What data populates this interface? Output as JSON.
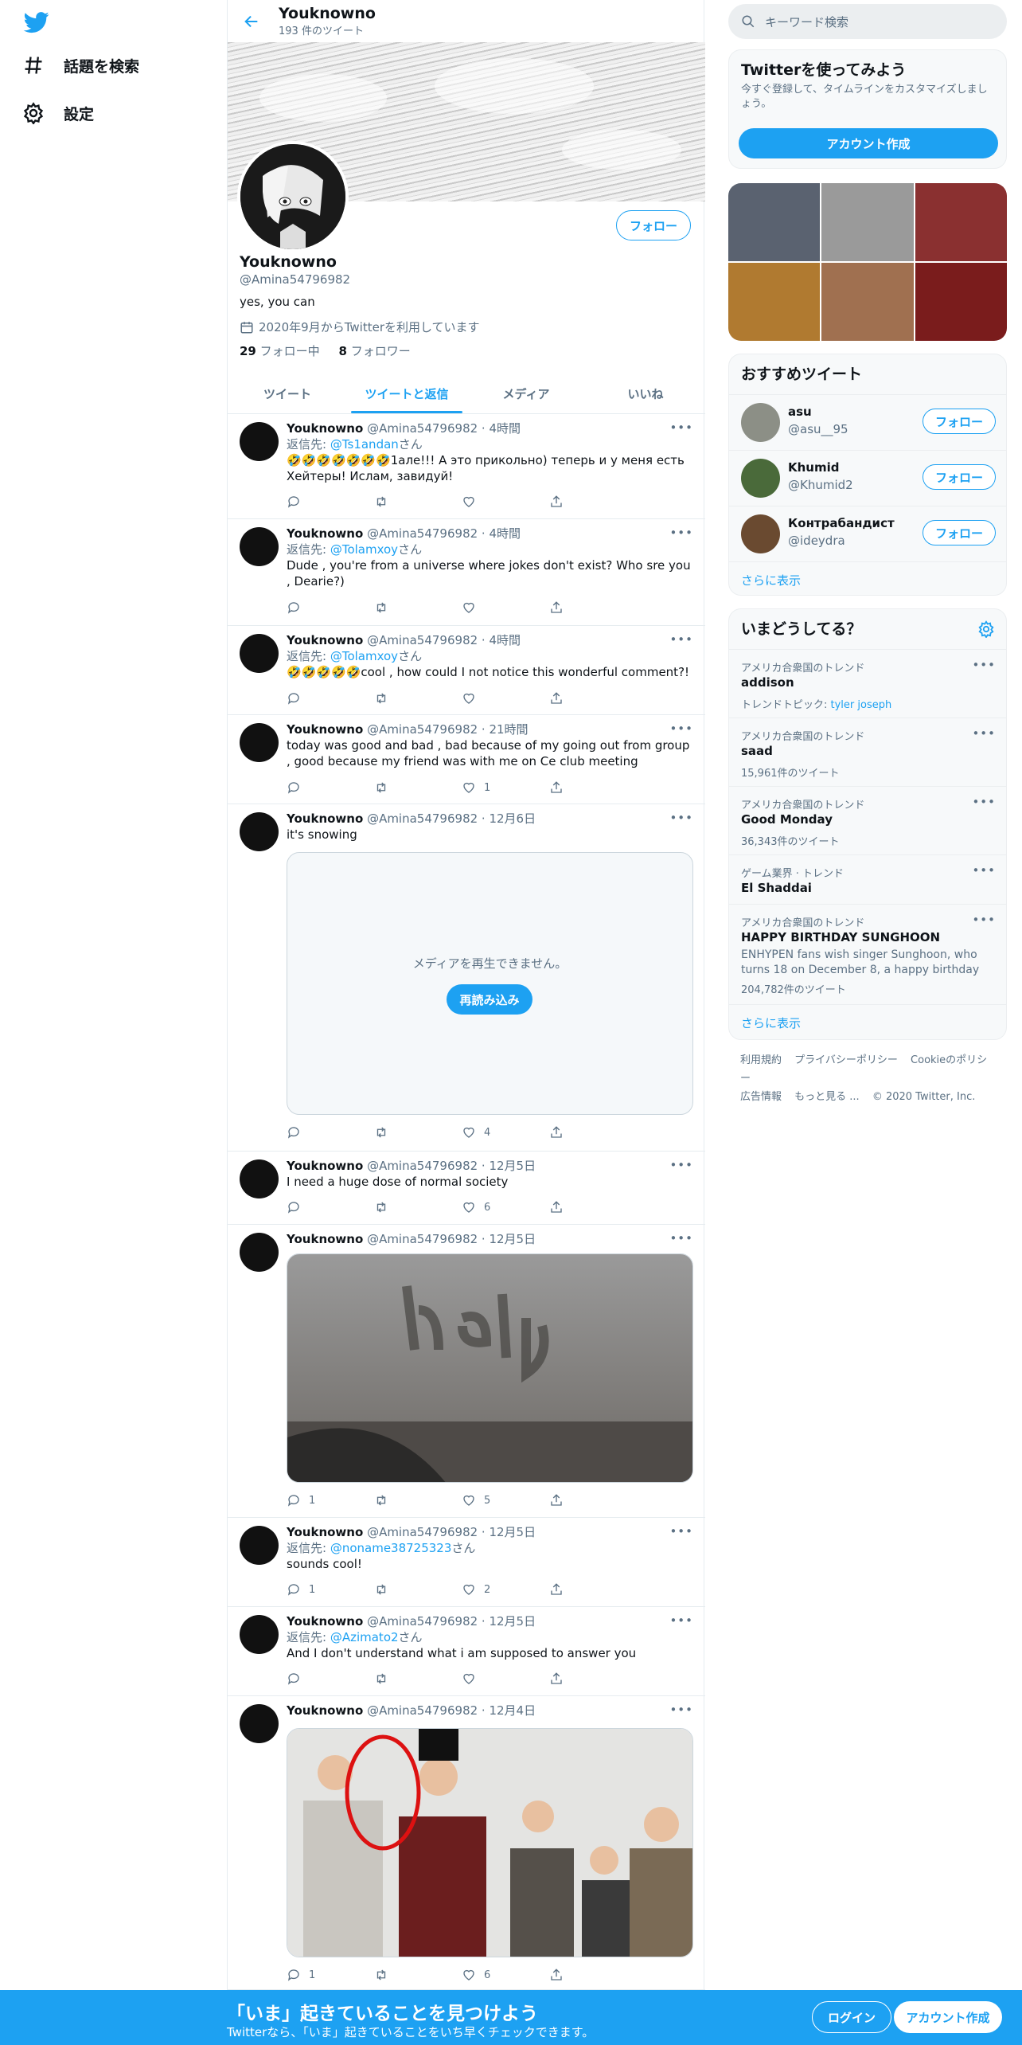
{
  "nav": {
    "explore_label": "話題を検索",
    "settings_label": "設定"
  },
  "header": {
    "name": "Youknowno",
    "tweet_count": "193 件のツイート"
  },
  "profile": {
    "name": "Youknowno",
    "handle": "@Amina54796982",
    "bio": "yes, you can",
    "joined": "2020年9月からTwitterを利用しています",
    "following_count": "29",
    "following_label": "フォロー中",
    "followers_count": "8",
    "followers_label": "フォロワー",
    "follow_button": "フォロー"
  },
  "tabs": [
    "ツイート",
    "ツイートと返信",
    "メディア",
    "いいね"
  ],
  "tweets": [
    {
      "name": "Youknowno",
      "meta": "@Amina54796982 · 4時間",
      "reply_prefix": "返信先: ",
      "reply_to": "@Ts1andan",
      "reply_suffix": "さん",
      "text": "🤣🤣🤣🤣🤣🤣🤣1але!!! А это прикольно) теперь и у меня есть Хейтеры! Ислам, завидуй!",
      "replies": "",
      "likes": ""
    },
    {
      "name": "Youknowno",
      "meta": "@Amina54796982 · 4時間",
      "reply_prefix": "返信先: ",
      "reply_to": "@Tolamxoy",
      "reply_suffix": "さん",
      "text": "Dude , you're from a universe where jokes don't exist? Who sre you , Dearie?)",
      "replies": "",
      "likes": ""
    },
    {
      "name": "Youknowno",
      "meta": "@Amina54796982 · 4時間",
      "reply_prefix": "返信先: ",
      "reply_to": "@Tolamxoy",
      "reply_suffix": "さん",
      "text": "🤣🤣🤣🤣🤣cool , how could I not notice this wonderful comment?!",
      "replies": "",
      "likes": ""
    },
    {
      "name": "Youknowno",
      "meta": "@Amina54796982 · 21時間",
      "text": "today was good and bad , bad because of  my going out from group , good because my friend was with me on Ce club meeting",
      "replies": "",
      "likes": "1"
    },
    {
      "name": "Youknowno",
      "meta": "@Amina54796982 · 12月6日",
      "text": "it's snowing",
      "media_error": "メディアを再生できません。",
      "reload": "再読み込み",
      "replies": "",
      "likes": "4"
    },
    {
      "name": "Youknowno",
      "meta": "@Amina54796982 · 12月5日",
      "text": "I need a huge dose of normal society",
      "replies": "",
      "likes": "6"
    },
    {
      "name": "Youknowno",
      "meta": "@Amina54796982 · 12月5日",
      "text": "",
      "replies": "1",
      "likes": "5"
    },
    {
      "name": "Youknowno",
      "meta": "@Amina54796982 · 12月5日",
      "reply_prefix": "返信先: ",
      "reply_to": "@noname38725323",
      "reply_suffix": "さん",
      "text": "sounds cool!",
      "replies": "1",
      "likes": "2"
    },
    {
      "name": "Youknowno",
      "meta": "@Amina54796982 · 12月5日",
      "reply_prefix": "返信先: ",
      "reply_to": "@Azimato2",
      "reply_suffix": "さん",
      "text": "And I don't understand what i am supposed to answer you",
      "replies": "",
      "likes": ""
    },
    {
      "name": "Youknowno",
      "meta": "@Amina54796982 · 12月4日",
      "text": "",
      "replies": "1",
      "likes": "6"
    }
  ],
  "search": {
    "placeholder": "キーワード検索"
  },
  "signup_card": {
    "title": "Twitterを使ってみよう",
    "desc": "今すぐ登録して、タイムラインをカスタマイズしましょう。",
    "button": "アカウント作成"
  },
  "suggestions": {
    "title": "おすすめツイート",
    "users": [
      {
        "name": "asu",
        "handle": "@asu__95",
        "button": "フォロー"
      },
      {
        "name": "Khumid",
        "handle": "@Khumid2",
        "button": "フォロー"
      },
      {
        "name": "Контрабандист",
        "handle": "@ideydra",
        "button": "フォロー"
      }
    ],
    "more": "さらに表示"
  },
  "trends": {
    "title": "いまどうしてる？",
    "items": [
      {
        "category": "アメリカ合衆国のトレンド",
        "name": "addison",
        "sub_label": "トレンドトピック: ",
        "sub_link": "tyler joseph"
      },
      {
        "category": "アメリカ合衆国のトレンド",
        "name": "saad",
        "count": "15,961件のツイート"
      },
      {
        "category": "アメリカ合衆国のトレンド",
        "name": "Good Monday",
        "count": "36,343件のツイート"
      },
      {
        "category": "ゲーム業界 · トレンド",
        "name": "El Shaddai"
      },
      {
        "category": "アメリカ合衆国のトレンド",
        "name": "HAPPY BIRTHDAY SUNGHOON",
        "desc": "ENHYPEN fans wish singer Sunghoon, who turns 18 on December 8, a happy birthday",
        "count": "204,782件のツイート"
      }
    ],
    "more": "さらに表示"
  },
  "footer": {
    "terms": "利用規約",
    "privacy": "プライバシーポリシー",
    "cookie": "Cookieのポリシー",
    "ads": "広告情報",
    "more": "もっと見る ...",
    "copyright": "© 2020 Twitter, Inc."
  },
  "bottom_bar": {
    "title": "「いま」起きていることを見つけよう",
    "subtitle": "Twitterなら、「いま」起きていることをいち早くチェックできます。",
    "login": "ログイン",
    "signup": "アカウント作成"
  },
  "colors": {
    "accent": "#1da1f2",
    "muted": "#5b7083"
  }
}
